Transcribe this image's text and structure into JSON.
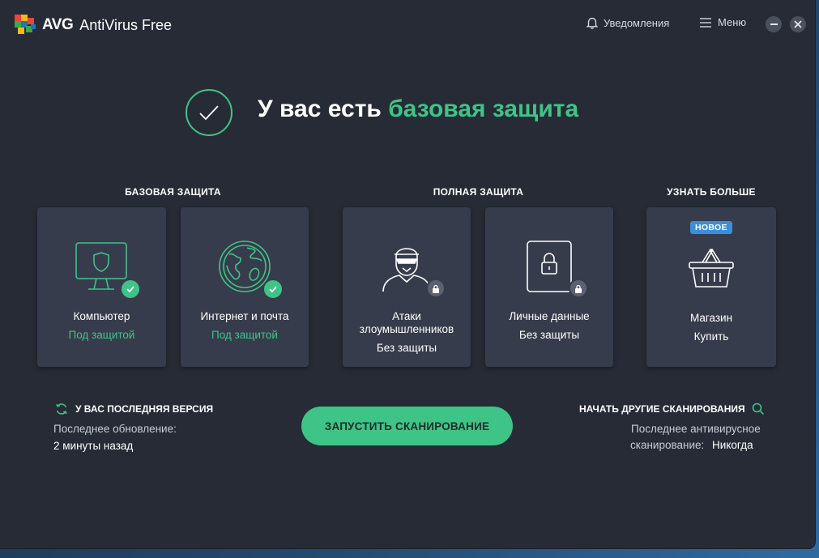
{
  "app": {
    "brand": "AVG",
    "product": "AntiVirus Free",
    "notifications_label": "Уведомления",
    "menu_label": "Меню"
  },
  "hero": {
    "title_prefix": "У вас есть",
    "title_accent": "базовая защита"
  },
  "sections": {
    "basic": "БАЗОВАЯ ЗАЩИТА",
    "full": "ПОЛНАЯ ЗАЩИТА",
    "more": "УЗНАТЬ БОЛЬШЕ"
  },
  "cards": [
    {
      "title": "Компьютер",
      "status": "Под защитой",
      "icon": "monitor-shield-icon",
      "badge": "check-icon"
    },
    {
      "title": "Интернет и почта",
      "status": "Под защитой",
      "icon": "globe-icon",
      "badge": "check-icon"
    },
    {
      "title_line1": "Атаки",
      "title_line2": "злоумышленников",
      "status": "Без защиты",
      "icon": "hacker-icon",
      "badge": "lock-icon"
    },
    {
      "title": "Личные данные",
      "status": "Без защиты",
      "icon": "lock-document-icon",
      "badge": "lock-icon"
    },
    {
      "title": "Магазин",
      "status": "Купить",
      "icon": "shopping-basket-icon",
      "tag": "НОВОЕ"
    }
  ],
  "update": {
    "title": "У ВАС ПОСЛЕДНЯЯ ВЕРСИЯ",
    "last_update_label": "Последнее обновление:",
    "last_update_value": "2 минуты назад"
  },
  "scan_button": "ЗАПУСТИТЬ СКАНИРОВАНИЕ",
  "other_scans": {
    "title": "НАЧАТЬ ДРУГИЕ СКАНИРОВАНИЯ",
    "last_scan_line1": "Последнее антивирусное",
    "last_scan_label": "сканирование:",
    "last_scan_value": "Никогда"
  },
  "colors": {
    "accent": "#3ec487",
    "window_bg": "#262b36",
    "card_bg": "#373c4c",
    "new_badge": "#3a8fd8"
  }
}
